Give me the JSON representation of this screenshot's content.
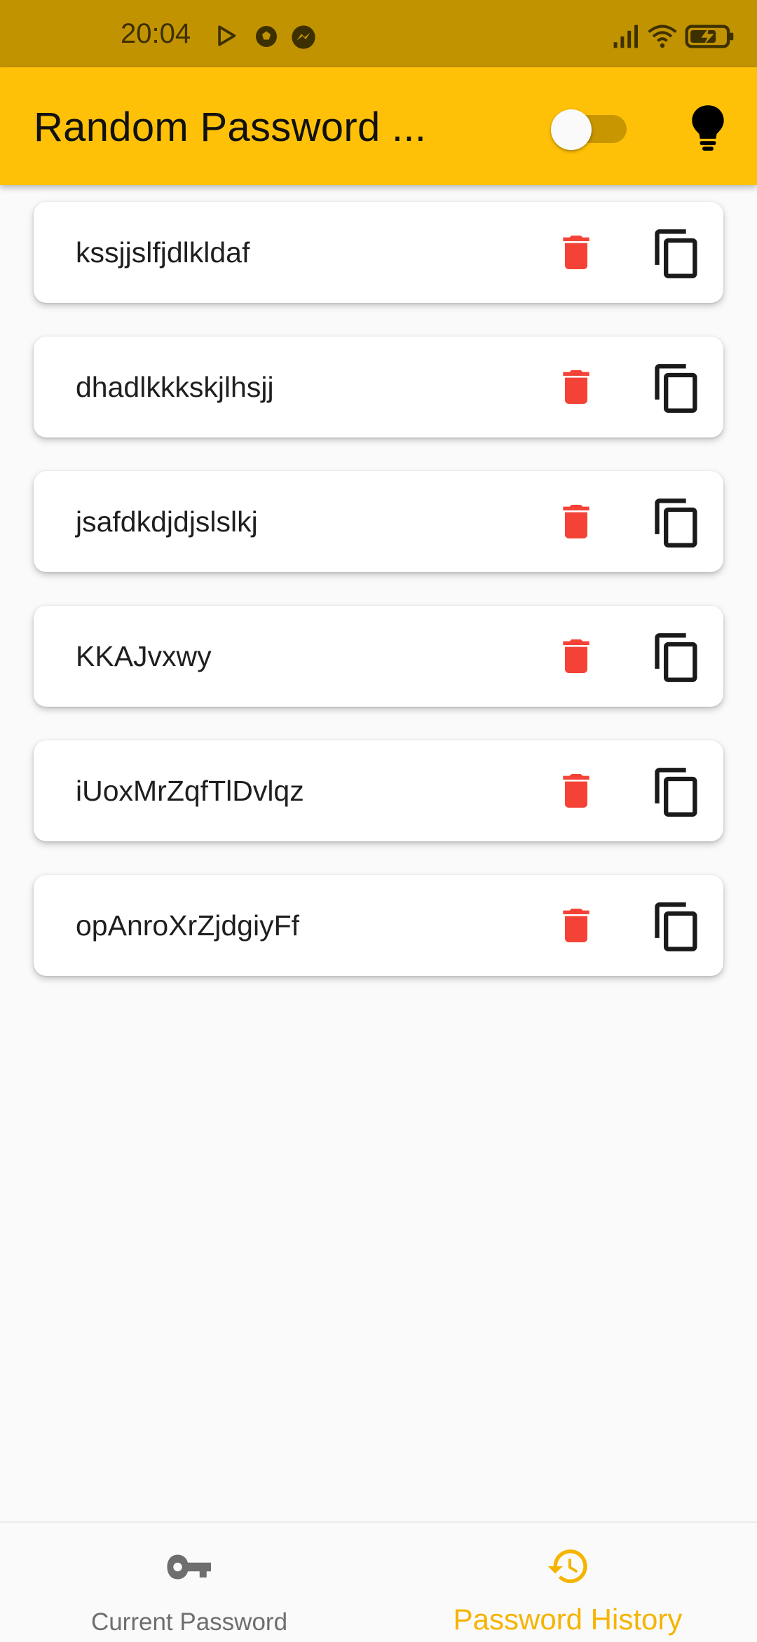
{
  "status_bar": {
    "time": "20:04",
    "icons": [
      "play-store-icon",
      "soccer-ball-icon",
      "messenger-icon",
      "signal-icon",
      "wifi-icon",
      "battery-charging-icon"
    ]
  },
  "app_bar": {
    "title": "Random Password ...",
    "theme_toggle_on": false,
    "action_icon": "lightbulb-icon"
  },
  "password_history": [
    {
      "password": "kssjjslfjdlkldaf"
    },
    {
      "password": "dhadlkkkskjlhsjj"
    },
    {
      "password": "jsafdkdjdjslslkj"
    },
    {
      "password": "KKAJvxwy"
    },
    {
      "password": "iUoxMrZqfTlDvlqz"
    },
    {
      "password": "opAnroXrZjdgiyFf"
    }
  ],
  "bottom_nav": {
    "items": [
      {
        "label": "Current Password",
        "icon": "key-icon",
        "selected": false
      },
      {
        "label": "Password History",
        "icon": "history-icon",
        "selected": true
      }
    ]
  },
  "colors": {
    "status_bar": "#c19300",
    "app_bar": "#ffc107",
    "accent": "#f5b400",
    "delete": "#f44336",
    "background": "#fafafa"
  }
}
